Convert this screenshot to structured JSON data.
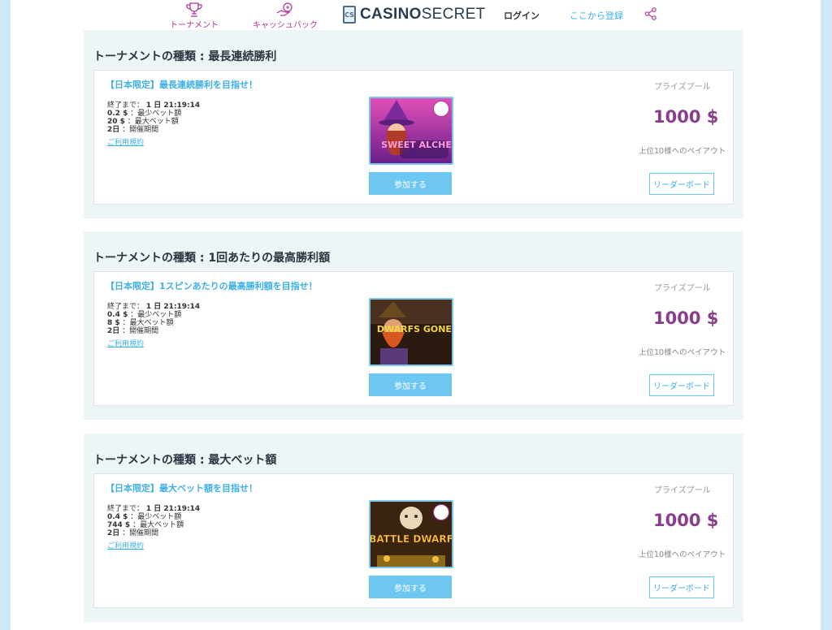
{
  "header": {
    "nav_tournament": "トーナメント",
    "nav_cashback": "キャッシュバック",
    "logo_bold": "CASINO",
    "logo_light": "SECRET",
    "logo_mark": "CS",
    "login": "ログイン",
    "register": "ここから登録"
  },
  "tournaments": [
    {
      "type_title": "トーナメントの種類 : 最長連続勝利",
      "card_title": "【日本限定】最長連続勝利を目指せ！",
      "ends_label": "終了まで：",
      "ends_value": "1 日 21:19:14",
      "min_bet_value": "0.2 $",
      "min_bet_label": "：最少ベット額",
      "max_bet_value": "20 $",
      "max_bet_label": "：最大ベット額",
      "duration_value": "2日",
      "duration_label": "：開催期間",
      "terms": "ご利用規約",
      "game": "SWEET ALCHEMY",
      "join": "参加する",
      "prize_label": "プライズプール",
      "prize_amount": "1000 $",
      "payout": "上位10様へのペイアウト",
      "leaderboard": "リーダーボード"
    },
    {
      "type_title": "トーナメントの種類 : 1回あたりの最高勝利額",
      "card_title": "【日本限定】1スピンあたりの最高勝利額を目指せ！",
      "ends_label": "終了まで：",
      "ends_value": "1 日 21:19:14",
      "min_bet_value": "0.4 $",
      "min_bet_label": "：最少ベット額",
      "max_bet_value": "8 $",
      "max_bet_label": "：最大ベット額",
      "duration_value": "2日",
      "duration_label": "：開催期間",
      "terms": "ご利用規約",
      "game": "DWARFS GONE WILD",
      "join": "参加する",
      "prize_label": "プライズプール",
      "prize_amount": "1000 $",
      "payout": "上位10様へのペイアウト",
      "leaderboard": "リーダーボード"
    },
    {
      "type_title": "トーナメントの種類 : 最大ベット額",
      "card_title": "【日本限定】最大ベット額を目指せ！",
      "ends_label": "終了まで：",
      "ends_value": "1 日 21:19:14",
      "min_bet_value": "0.4 $",
      "min_bet_label": "：最少ベット額",
      "max_bet_value": "744 $",
      "max_bet_label": "：最大ベット額",
      "duration_value": "2日",
      "duration_label": "：開催期間",
      "terms": "ご利用規約",
      "game": "BATTLE DWARF",
      "join": "参加する",
      "prize_label": "プライズプール",
      "prize_amount": "1000 $",
      "payout": "上位10様へのペイアウト",
      "leaderboard": "リーダーボード"
    }
  ]
}
